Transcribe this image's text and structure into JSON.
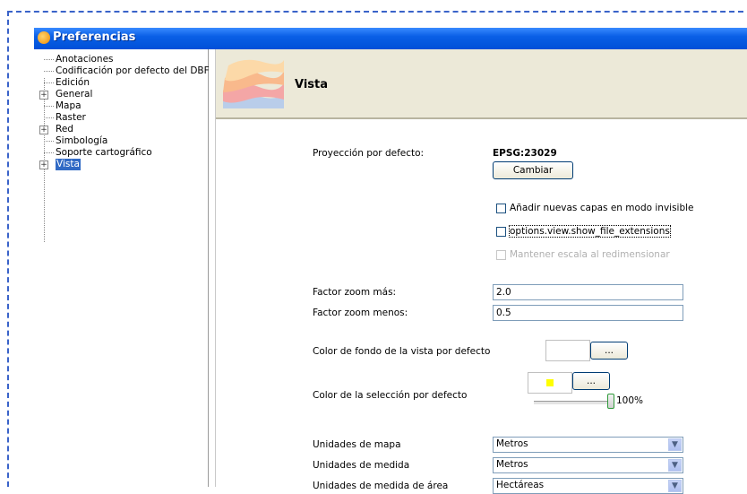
{
  "window": {
    "title": "Preferencias"
  },
  "tree": {
    "items": [
      {
        "label": "Anotaciones",
        "expandable": false
      },
      {
        "label": "Codificación por defecto del DBF",
        "expandable": false
      },
      {
        "label": "Edición",
        "expandable": false
      },
      {
        "label": "General",
        "expandable": true
      },
      {
        "label": "Mapa",
        "expandable": false
      },
      {
        "label": "Raster",
        "expandable": false
      },
      {
        "label": "Red",
        "expandable": true
      },
      {
        "label": "Simbología",
        "expandable": false
      },
      {
        "label": "Soporte cartográfico",
        "expandable": false
      },
      {
        "label": "Vista",
        "expandable": true,
        "selected": true
      }
    ],
    "expander_symbol": "+"
  },
  "panel": {
    "title": "Vista",
    "projection": {
      "label": "Proyección por defecto:",
      "value": "EPSG:23029",
      "button": "Cambiar"
    },
    "checkboxes": [
      {
        "label": "Añadir nuevas capas en modo invisible",
        "checked": false,
        "enabled": true
      },
      {
        "label": "options.view.show_file_extensions",
        "checked": false,
        "enabled": true
      },
      {
        "label": "Mantener escala al redimensionar",
        "checked": false,
        "enabled": false
      }
    ],
    "zoom_in": {
      "label": "Factor zoom más:",
      "value": "2.0"
    },
    "zoom_out": {
      "label": "Factor zoom menos:",
      "value": "0.5"
    },
    "bg_color": {
      "label": "Color de fondo de la vista por defecto",
      "button": "...",
      "color": "#ffffff"
    },
    "sel_color": {
      "label": "Color de la selección por defecto",
      "button": "...",
      "color": "#ffff00",
      "alpha_percent": "100%",
      "alpha": 1.0
    },
    "map_units": {
      "label": "Unidades de mapa",
      "value": "Metros"
    },
    "measure_units": {
      "label": "Unidades de medida",
      "value": "Metros"
    },
    "area_units": {
      "label": "Unidades de medida de área",
      "value": "Hectáreas"
    }
  },
  "colors": {
    "titlebar": "#0a5fe6",
    "selection": "#316ac5",
    "dashed_border": "#3a63c9"
  }
}
